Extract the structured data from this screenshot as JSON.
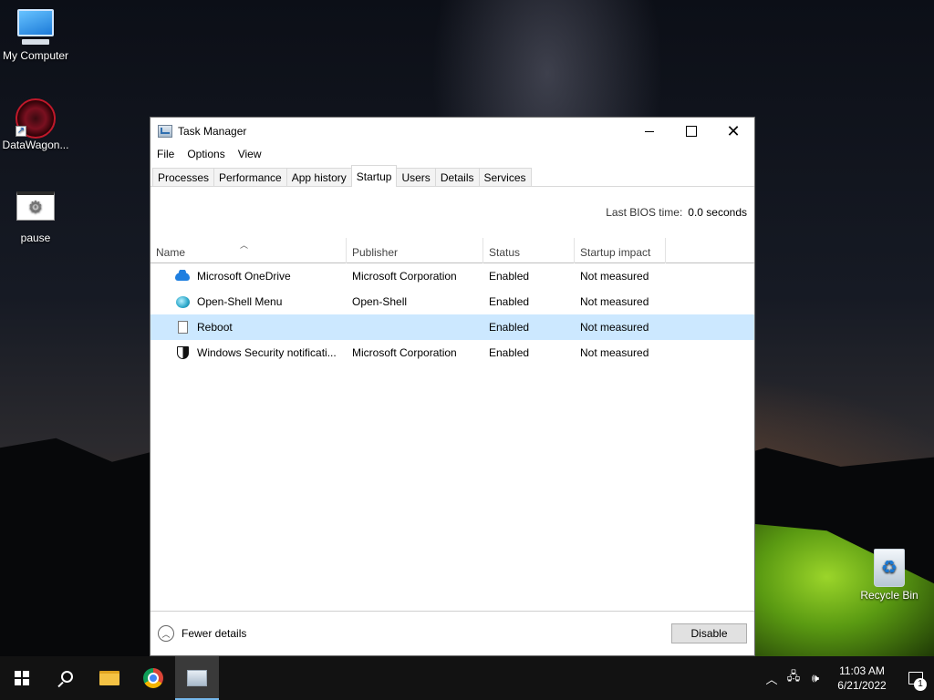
{
  "desktop": {
    "icons": [
      {
        "label": "My Computer"
      },
      {
        "label": "DataWagon..."
      },
      {
        "label": "pause"
      },
      {
        "label": "Recycle Bin"
      }
    ]
  },
  "window": {
    "title": "Task Manager",
    "menu": [
      "File",
      "Options",
      "View"
    ],
    "tabs": [
      "Processes",
      "Performance",
      "App history",
      "Startup",
      "Users",
      "Details",
      "Services"
    ],
    "active_tab": "Startup",
    "bios_label": "Last BIOS time:",
    "bios_value": "0.0 seconds",
    "columns": [
      "Name",
      "Publisher",
      "Status",
      "Startup impact"
    ],
    "rows": [
      {
        "name": "Microsoft OneDrive",
        "publisher": "Microsoft Corporation",
        "status": "Enabled",
        "impact": "Not measured",
        "icon": "onedrive-icon"
      },
      {
        "name": "Open-Shell Menu",
        "publisher": "Open-Shell",
        "status": "Enabled",
        "impact": "Not measured",
        "icon": "open-shell-icon"
      },
      {
        "name": "Reboot",
        "publisher": "",
        "status": "Enabled",
        "impact": "Not measured",
        "icon": "document-icon",
        "selected": true
      },
      {
        "name": "Windows Security notificati...",
        "publisher": "Microsoft Corporation",
        "status": "Enabled",
        "impact": "Not measured",
        "icon": "shield-icon"
      }
    ],
    "fewer_details": "Fewer details",
    "disable_button": "Disable"
  },
  "taskbar": {
    "time": "11:03 AM",
    "date": "6/21/2022",
    "notification_count": "1"
  },
  "colors": {
    "selected_row": "#cce8ff",
    "taskbar": "#121212",
    "accent": "#76b9ed"
  }
}
